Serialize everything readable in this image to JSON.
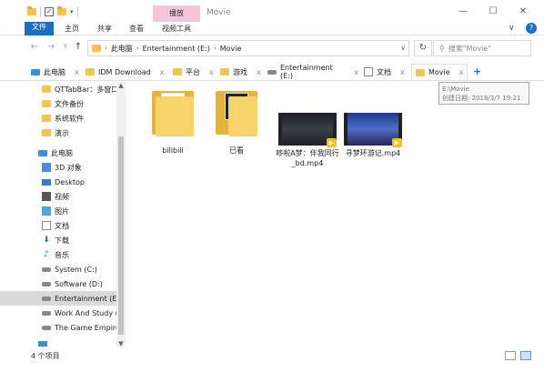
{
  "window": {
    "title": "Movie",
    "context_group": "播放"
  },
  "ribbon": {
    "tabs": [
      "文件",
      "主页",
      "共享",
      "查看",
      "视频工具"
    ]
  },
  "nav": {
    "path": [
      "此电脑",
      "Entertainment (E:)",
      "Movie"
    ],
    "search_placeholder": "搜索\"Movie\""
  },
  "tabs": [
    {
      "label": "此电脑",
      "icon": "pc-icon"
    },
    {
      "label": "IDM Download",
      "icon": "folder-icon"
    },
    {
      "label": "平台",
      "icon": "folder-icon"
    },
    {
      "label": "游戏",
      "icon": "folder-icon"
    },
    {
      "label": "Entertainment (E:)",
      "icon": "drive-icon"
    },
    {
      "label": "文档",
      "icon": "document-icon"
    },
    {
      "label": "Movie",
      "icon": "folder-icon"
    }
  ],
  "tooltip": {
    "path": "E:\\Movie",
    "created": "创建日期: 2018/3/7 19:21"
  },
  "sidebar": {
    "items": [
      {
        "label": "QTTabBar：多窗口",
        "icon": "folder"
      },
      {
        "label": "文件备份",
        "icon": "folder"
      },
      {
        "label": "系统软件",
        "icon": "folder"
      },
      {
        "label": "演示",
        "icon": "folder"
      },
      {
        "label": "此电脑",
        "icon": "pc"
      },
      {
        "label": "3D 对象",
        "icon": "cube"
      },
      {
        "label": "Desktop",
        "icon": "desk"
      },
      {
        "label": "视频",
        "icon": "video"
      },
      {
        "label": "图片",
        "icon": "pic"
      },
      {
        "label": "文档",
        "icon": "doc"
      },
      {
        "label": "下载",
        "icon": "down"
      },
      {
        "label": "音乐",
        "icon": "music"
      },
      {
        "label": "System (C:)",
        "icon": "drive"
      },
      {
        "label": "Software (D:)",
        "icon": "drive"
      },
      {
        "label": "Entertainment (E:)",
        "icon": "drive"
      },
      {
        "label": "Work And Study (",
        "icon": "drive"
      },
      {
        "label": "The Game Empire",
        "icon": "drive"
      },
      {
        "label": "",
        "icon": "netdrive"
      }
    ]
  },
  "files": [
    {
      "name": "bilibili",
      "type": "folder"
    },
    {
      "name": "已看",
      "type": "folder-dark"
    },
    {
      "name": "哆啦A梦：伴我同行_bd.mp4",
      "type": "video1"
    },
    {
      "name": "寻梦环游记.mp4",
      "type": "video2"
    }
  ],
  "status": {
    "count": "4 个项目"
  }
}
